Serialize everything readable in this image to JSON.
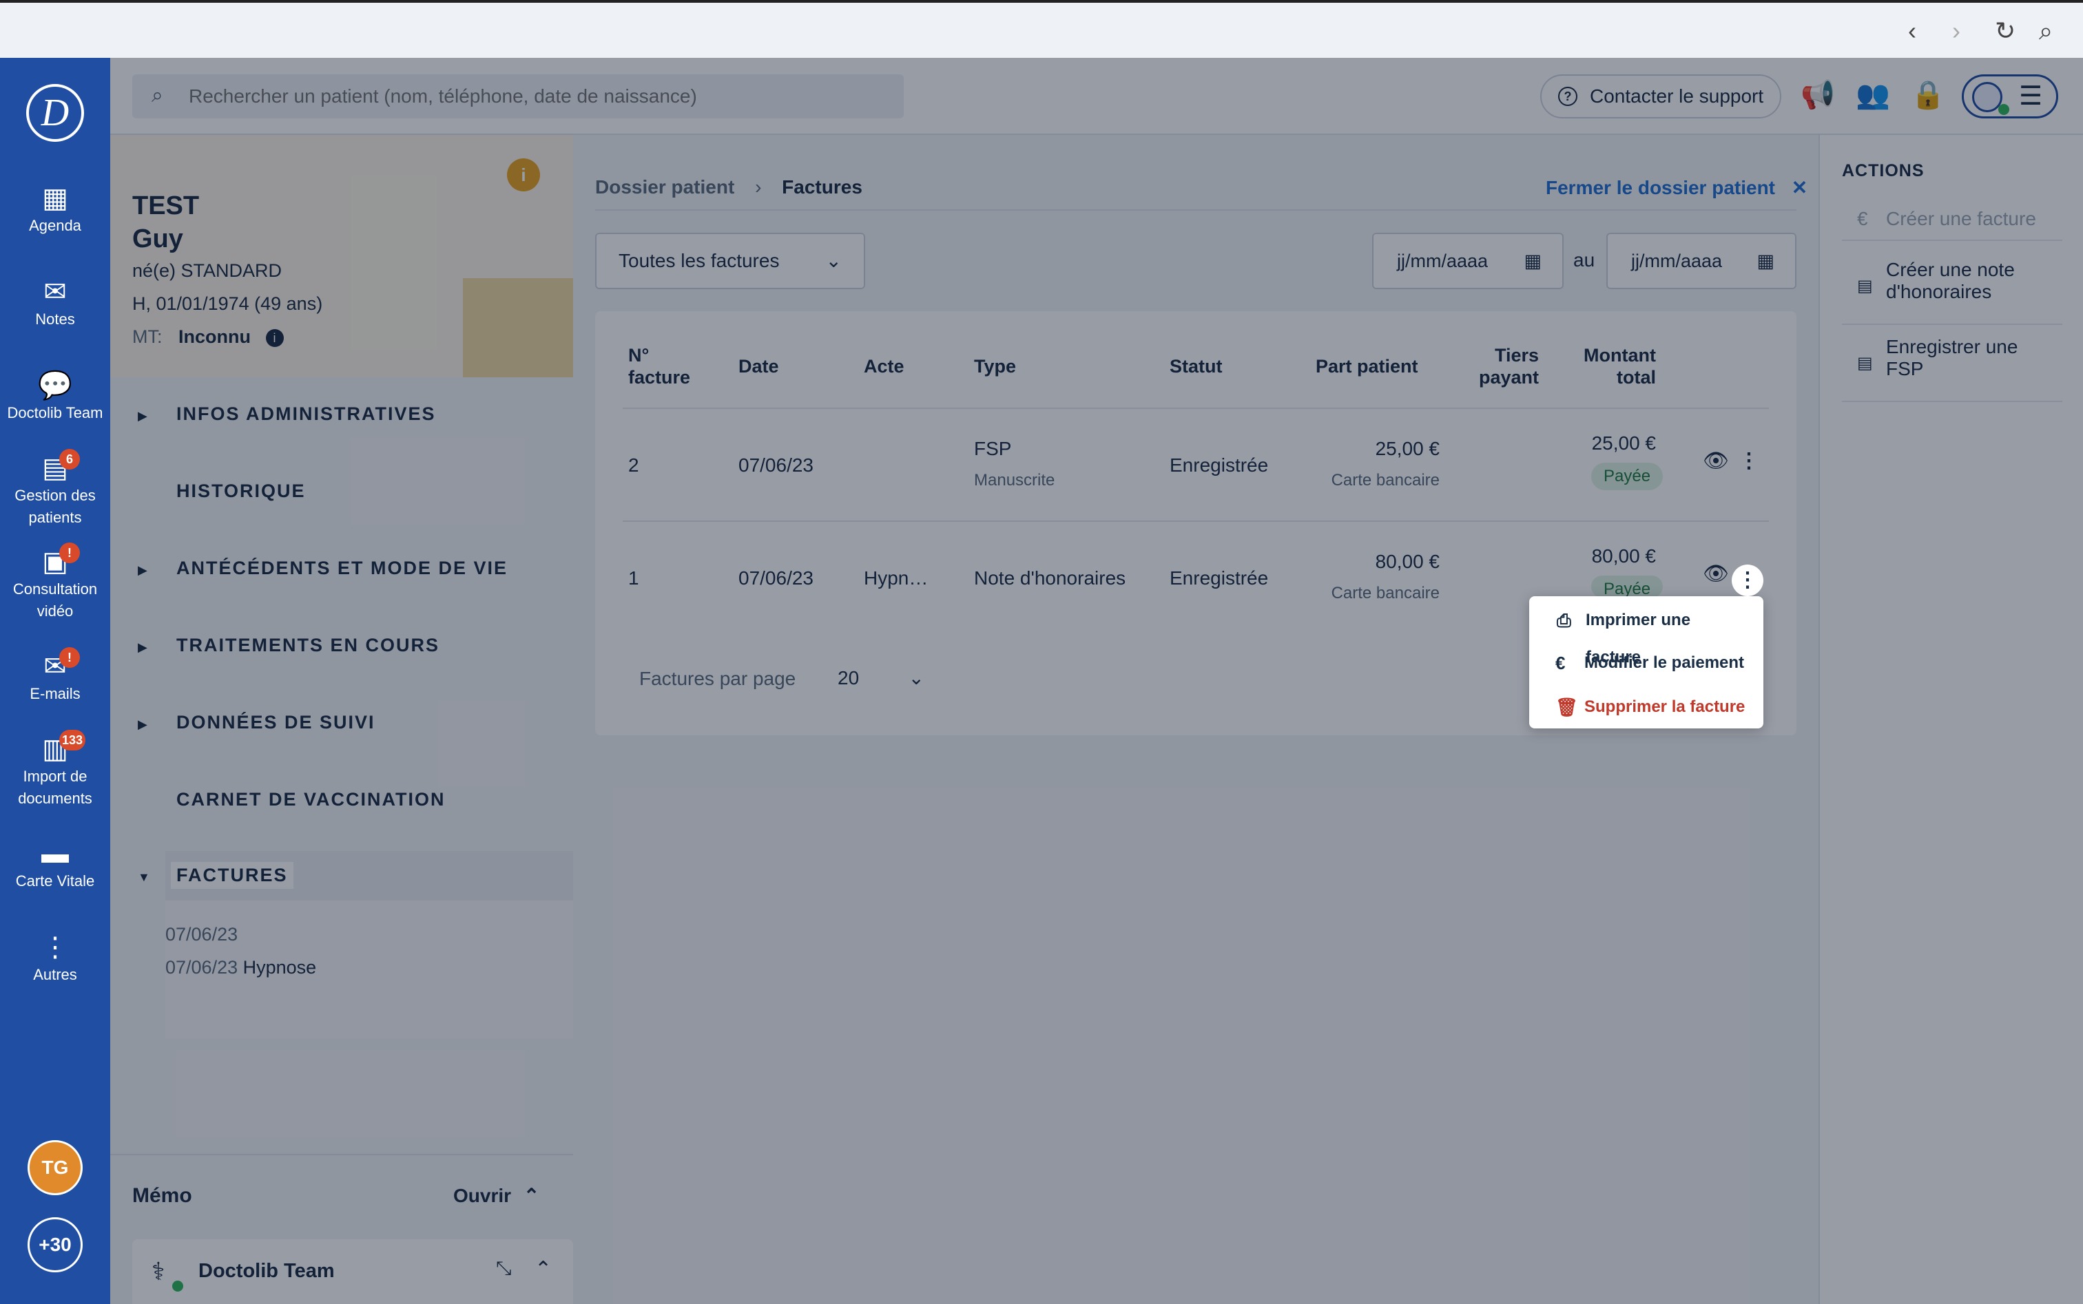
{
  "browser": {
    "back": "‹",
    "forward": "›",
    "reload": "↻",
    "zoom": "⌕"
  },
  "nav": {
    "logo": "D",
    "items": [
      {
        "label": "Agenda",
        "icon": "calendar-icon",
        "glyph": "▦"
      },
      {
        "label": "Notes",
        "icon": "envelope-icon",
        "glyph": "✉"
      },
      {
        "label": "Doctolib Team",
        "icon": "chat-icon",
        "glyph": "💬"
      },
      {
        "label": "Gestion des patients",
        "icon": "patients-icon",
        "glyph": "▤",
        "badge": "6"
      },
      {
        "label": "Consultation vidéo",
        "icon": "video-icon",
        "glyph": "▣",
        "badge": "!"
      },
      {
        "label": "E-mails",
        "icon": "mail-icon",
        "glyph": "✉",
        "badge": "!"
      },
      {
        "label": "Import de documents",
        "icon": "document-icon",
        "glyph": "▥",
        "badge": "133"
      },
      {
        "label": "Carte Vitale",
        "icon": "card-icon",
        "glyph": "▬"
      },
      {
        "label": "Autres",
        "icon": "more-icon",
        "glyph": "⋮"
      }
    ],
    "avatar": "TG",
    "more_count": "+30"
  },
  "topbar": {
    "search_placeholder": "Rechercher un patient (nom, téléphone, date de naissance)",
    "support_label": "Contacter le support"
  },
  "patient": {
    "lastname": "TEST",
    "firstname": "Guy",
    "birth_name": "né(e) STANDARD",
    "sex_birth": "H, 01/01/1974 (49 ans)",
    "mt_label": "MT:",
    "mt_value": "Inconnu",
    "sections": [
      "INFOS ADMINISTRATIVES",
      "HISTORIQUE",
      "ANTÉCÉDENTS ET MODE DE VIE",
      "TRAITEMENTS EN COURS",
      "DONNÉES DE SUIVI",
      "CARNET DE VACCINATION",
      "FACTURES"
    ],
    "factures": [
      {
        "date": "07/06/23",
        "label": ""
      },
      {
        "date": "07/06/23",
        "label": "Hypnose"
      }
    ],
    "memo_title": "Mémo",
    "memo_open": "Ouvrir",
    "team_label": "Doctolib Team"
  },
  "main": {
    "breadcrumb_root": "Dossier patient",
    "breadcrumb_current": "Factures",
    "close_label": "Fermer le dossier patient",
    "filter_value": "Toutes les factures",
    "date_from_placeholder": "jj/mm/aaaa",
    "date_sep": "au",
    "date_to_placeholder": "jj/mm/aaaa",
    "columns": {
      "num_1": "N°",
      "num_2": "facture",
      "date": "Date",
      "acte": "Acte",
      "type": "Type",
      "statut": "Statut",
      "part": "Part patient",
      "tiers_1": "Tiers",
      "tiers_2": "payant",
      "montant_1": "Montant",
      "montant_2": "total"
    },
    "rows": [
      {
        "num": "2",
        "date": "07/06/23",
        "acte": "",
        "type": "FSP",
        "type_sub": "Manuscrite",
        "statut": "Enregistrée",
        "part": "25,00 €",
        "part_sub": "Carte bancaire",
        "montant": "25,00 €",
        "badge": "Payée"
      },
      {
        "num": "1",
        "date": "07/06/23",
        "acte": "Hypn…",
        "type": "Note d'honoraires",
        "type_sub": "",
        "statut": "Enregistrée",
        "part": "80,00 €",
        "part_sub": "Carte bancaire",
        "montant": "80,00 €",
        "badge": "Payée"
      }
    ],
    "per_page_label": "Factures par page",
    "per_page_value": "20",
    "menu": {
      "print": "Imprimer une facture",
      "edit": "Modifier le paiement",
      "delete": "Supprimer la facture"
    }
  },
  "actions": {
    "title": "ACTIONS",
    "create_invoice": "Créer une facture",
    "create_note_1": "Créer une note",
    "create_note_2": "d'honoraires",
    "register_fsp_1": "Enregistrer une",
    "register_fsp_2": "FSP"
  },
  "colors": {
    "nav": "#1f4ea3",
    "accent": "#1f6fd1",
    "danger": "#c0392b",
    "badge": "#d94a2a"
  }
}
